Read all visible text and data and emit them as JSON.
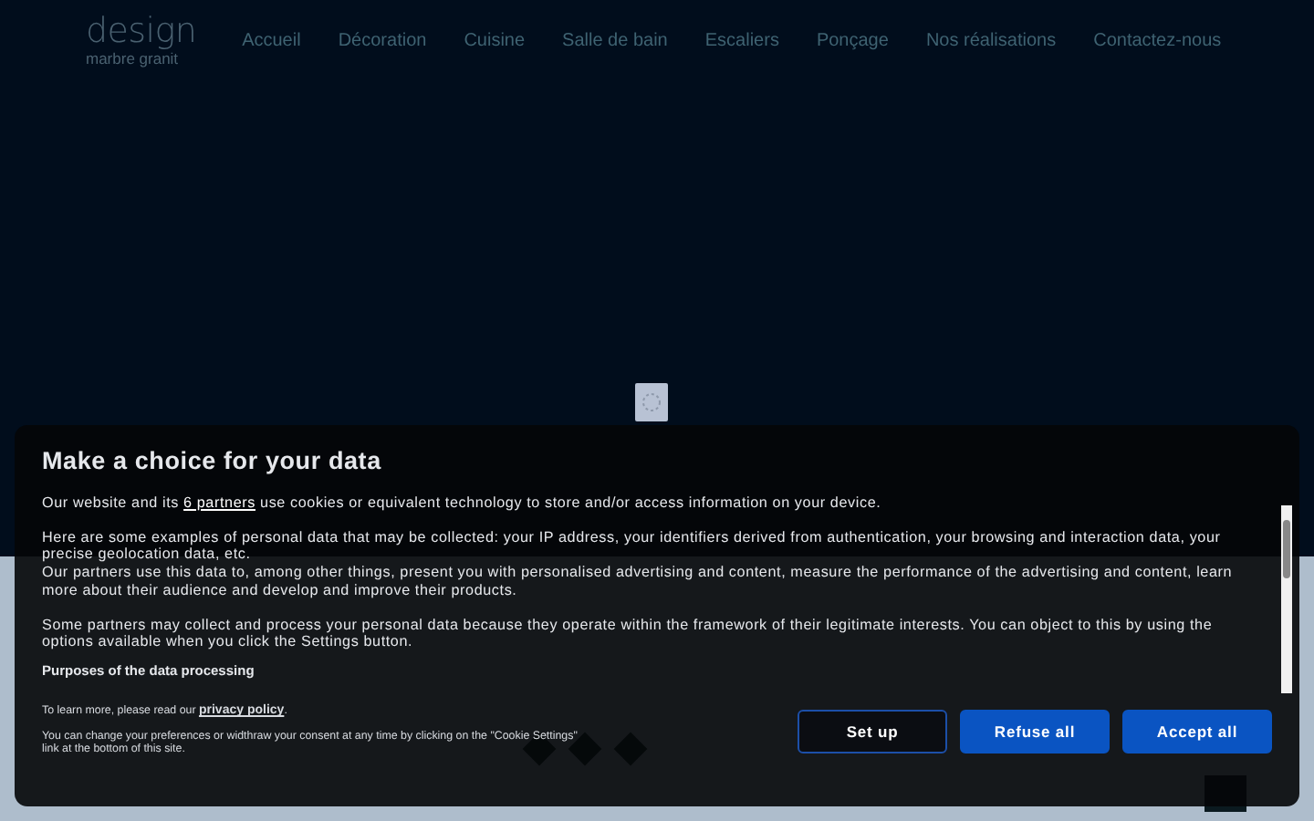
{
  "logo": {
    "title": "design",
    "subtitle": "marbre granit"
  },
  "nav": [
    {
      "label": "Accueil"
    },
    {
      "label": "Décoration"
    },
    {
      "label": "Cuisine"
    },
    {
      "label": "Salle de bain"
    },
    {
      "label": "Escaliers"
    },
    {
      "label": "Ponçage"
    },
    {
      "label": "Nos réalisations"
    },
    {
      "label": "Contactez-nous"
    }
  ],
  "consent": {
    "title": "Make a choice for your data",
    "intro": {
      "before": "Our website and its",
      "link": "6 partners",
      "after": "use cookies or equivalent technology to store and/or access information on your device."
    },
    "paragraphs": [
      "Here are some examples of personal data that may be collected: your IP address, your identifiers derived from authentication, your browsing and interaction data, your precise geolocation data, etc.\nOur partners use this data to, among other things, present you with personalised advertising and content, measure the performance of the advertising and content, learn more about their audience and develop and improve their products.",
      "Some partners may collect and process your personal data because they operate within the framework of their legitimate interests. You can object to this by using the options available when you click the Settings button."
    ],
    "subheading": "Purposes of the data processing",
    "privacy_before": "To learn more, please read our",
    "privacy_link": "privacy policy",
    "privacy_after": ".",
    "footer_note": "You can change your preferences or widthraw your consent at any time by clicking on the \"Cookie Settings\" link at the bottom of this site.",
    "buttons": [
      {
        "label": "Set up",
        "kind": "outline"
      },
      {
        "label": "Refuse all",
        "kind": "filled"
      },
      {
        "label": "Accept all",
        "kind": "filled"
      }
    ]
  }
}
